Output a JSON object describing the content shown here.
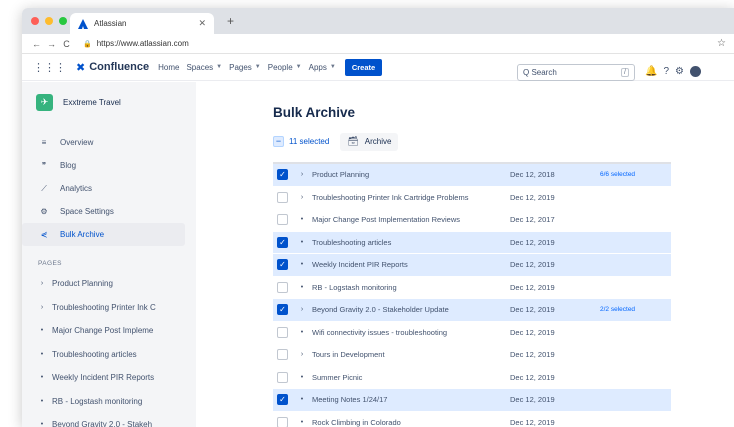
{
  "browser": {
    "tab_title": "Atlassian",
    "url": "https://www.atlassian.com",
    "dot_colors": [
      "#fe5f57",
      "#febc2e",
      "#28c840"
    ]
  },
  "topnav": {
    "product": "Confluence",
    "items": [
      "Home",
      "Spaces",
      "Pages",
      "People",
      "Apps"
    ],
    "create_label": "Create",
    "search_placeholder": "Q Search",
    "search_shortcut": "/"
  },
  "sidebar": {
    "space_name": "Exxtreme Travel",
    "menu": [
      {
        "icon": "overview-icon",
        "glyph": "≡",
        "label": "Overview",
        "active": false
      },
      {
        "icon": "quote-icon",
        "glyph": "❞",
        "label": "Blog",
        "active": false
      },
      {
        "icon": "chart-icon",
        "glyph": "⟋",
        "label": "Analytics",
        "active": false
      },
      {
        "icon": "gear-icon",
        "glyph": "⚙",
        "label": "Space Settings",
        "active": false
      },
      {
        "icon": "bulk-archive-icon",
        "glyph": "⋞",
        "label": "Bulk Archive",
        "active": true
      }
    ],
    "pages_label": "PAGES",
    "pages": [
      {
        "marker": "›",
        "label": "Product Planning"
      },
      {
        "marker": "›",
        "label": "Troubleshooting Printer Ink C"
      },
      {
        "marker": "•",
        "label": "Major Change Post Impleme"
      },
      {
        "marker": "•",
        "label": "Troubleshooting articles"
      },
      {
        "marker": "•",
        "label": "Weekly Incident PIR Reports"
      },
      {
        "marker": "•",
        "label": "RB - Logstash monitoring"
      },
      {
        "marker": "•",
        "label": "Beyond Gravity 2.0 - Stakeh"
      }
    ]
  },
  "main": {
    "title": "Bulk Archive",
    "selected_count": "11 selected",
    "archive_label": "Archive",
    "rows": [
      {
        "selected": true,
        "marker": "›",
        "title": "Product Planning",
        "date": "Dec 12, 2018",
        "sub": "6/6 selected"
      },
      {
        "selected": false,
        "marker": "›",
        "title": "Troubleshooting Printer Ink Cartridge Problems",
        "date": "Dec 12, 2019",
        "sub": ""
      },
      {
        "selected": false,
        "marker": "•",
        "title": "Major Change Post Implementation Reviews",
        "date": "Dec 12, 2017",
        "sub": ""
      },
      {
        "selected": true,
        "marker": "•",
        "title": "Troubleshooting articles",
        "date": "Dec 12, 2019",
        "sub": ""
      },
      {
        "selected": true,
        "marker": "•",
        "title": "Weekly Incident PIR Reports",
        "date": "Dec 12, 2019",
        "sub": ""
      },
      {
        "selected": false,
        "marker": "•",
        "title": "RB - Logstash monitoring",
        "date": "Dec 12, 2019",
        "sub": ""
      },
      {
        "selected": true,
        "marker": "›",
        "title": "Beyond Gravity 2.0 - Stakeholder Update",
        "date": "Dec 12, 2019",
        "sub": "2/2 selected"
      },
      {
        "selected": false,
        "marker": "•",
        "title": "Wifi connectivity issues - troubleshooting",
        "date": "Dec 12, 2019",
        "sub": ""
      },
      {
        "selected": false,
        "marker": "›",
        "title": "Tours in Development",
        "date": "Dec 12, 2019",
        "sub": ""
      },
      {
        "selected": false,
        "marker": "•",
        "title": "Summer Picnic",
        "date": "Dec 12, 2019",
        "sub": ""
      },
      {
        "selected": true,
        "marker": "•",
        "title": "Meeting Notes 1/24/17",
        "date": "Dec 12, 2019",
        "sub": ""
      },
      {
        "selected": false,
        "marker": "•",
        "title": "Rock Climbing in Colorado",
        "date": "Dec 12, 2019",
        "sub": ""
      }
    ]
  },
  "colors": {
    "brand": "#0052cc",
    "selected_row": "#deebff",
    "sidebar_bg": "#f4f5f7"
  }
}
